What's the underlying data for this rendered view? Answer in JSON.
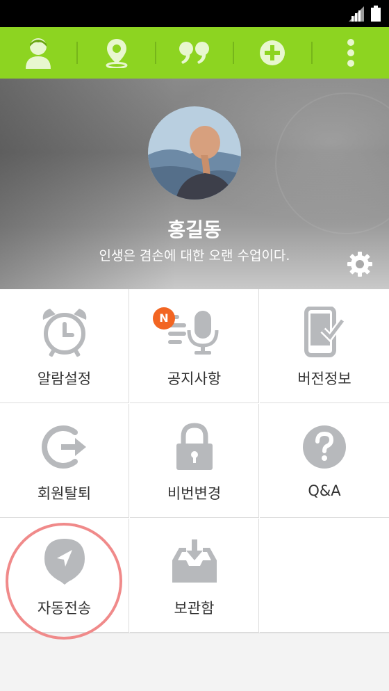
{
  "toolbar": {
    "buttons": [
      {
        "name": "profile-button",
        "icon": "person-icon"
      },
      {
        "name": "location-button",
        "icon": "location-pin-icon"
      },
      {
        "name": "quote-button",
        "icon": "quote-icon"
      },
      {
        "name": "add-button",
        "icon": "plus-circle-icon"
      },
      {
        "name": "more-button",
        "icon": "more-vertical-icon"
      }
    ],
    "color": "#8dd421"
  },
  "profile": {
    "name": "홍길동",
    "motto": "인생은 겸손에 대한 오랜 수업이다."
  },
  "menu": {
    "items": [
      {
        "label": "알람설정",
        "icon": "alarm-clock-icon"
      },
      {
        "label": "공지사항",
        "icon": "microphone-announcement-icon",
        "badge": "N"
      },
      {
        "label": "버전정보",
        "icon": "phone-check-icon"
      },
      {
        "label": "회원탈퇴",
        "icon": "logout-icon"
      },
      {
        "label": "비번변경",
        "icon": "lock-icon"
      },
      {
        "label": "Q&A",
        "icon": "question-icon"
      },
      {
        "label": "자동전송",
        "icon": "navigation-arrow-icon"
      },
      {
        "label": "보관함",
        "icon": "inbox-download-icon"
      }
    ]
  },
  "colors": {
    "icon_gray": "#b7b9bc",
    "badge": "#f26522",
    "highlight_ring": "#f08a8a"
  }
}
